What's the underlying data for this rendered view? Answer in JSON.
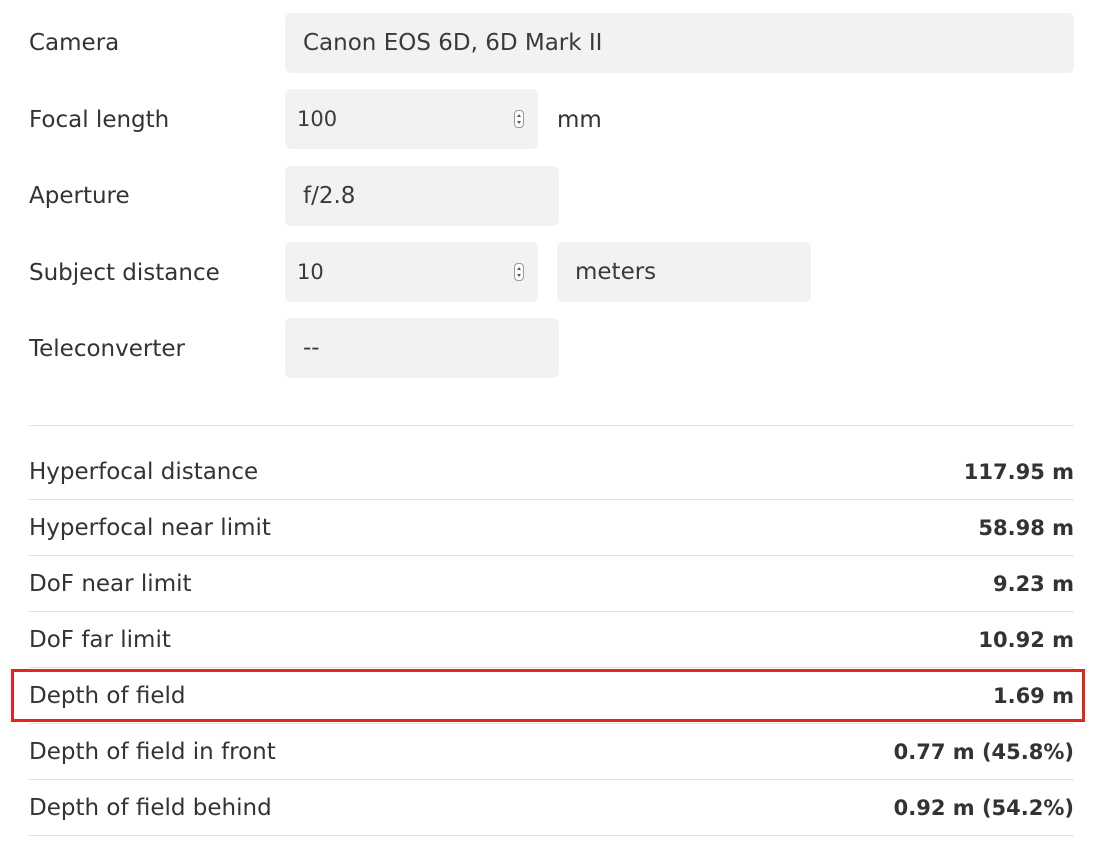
{
  "form": {
    "camera": {
      "label": "Camera",
      "value": "Canon EOS 6D, 6D Mark II"
    },
    "focal_length": {
      "label": "Focal length",
      "value": "100",
      "unit": "mm"
    },
    "aperture": {
      "label": "Aperture",
      "value": "f/2.8"
    },
    "subject_distance": {
      "label": "Subject distance",
      "value": "10",
      "unit": "meters"
    },
    "teleconverter": {
      "label": "Teleconverter",
      "value": "--"
    }
  },
  "results": [
    {
      "label": "Hyperfocal distance",
      "value": "117.95 m"
    },
    {
      "label": "Hyperfocal near limit",
      "value": "58.98 m"
    },
    {
      "label": "DoF near limit",
      "value": "9.23 m"
    },
    {
      "label": "DoF far limit",
      "value": "10.92 m"
    },
    {
      "label": "Depth of field",
      "value": "1.69 m",
      "highlighted": true
    },
    {
      "label": "Depth of field in front",
      "value": "0.77 m (45.8%)"
    },
    {
      "label": "Depth of field behind",
      "value": "0.92 m (54.2%)"
    }
  ],
  "colors": {
    "highlight_border": "#e5251e",
    "field_background": "#f2f2f2"
  }
}
